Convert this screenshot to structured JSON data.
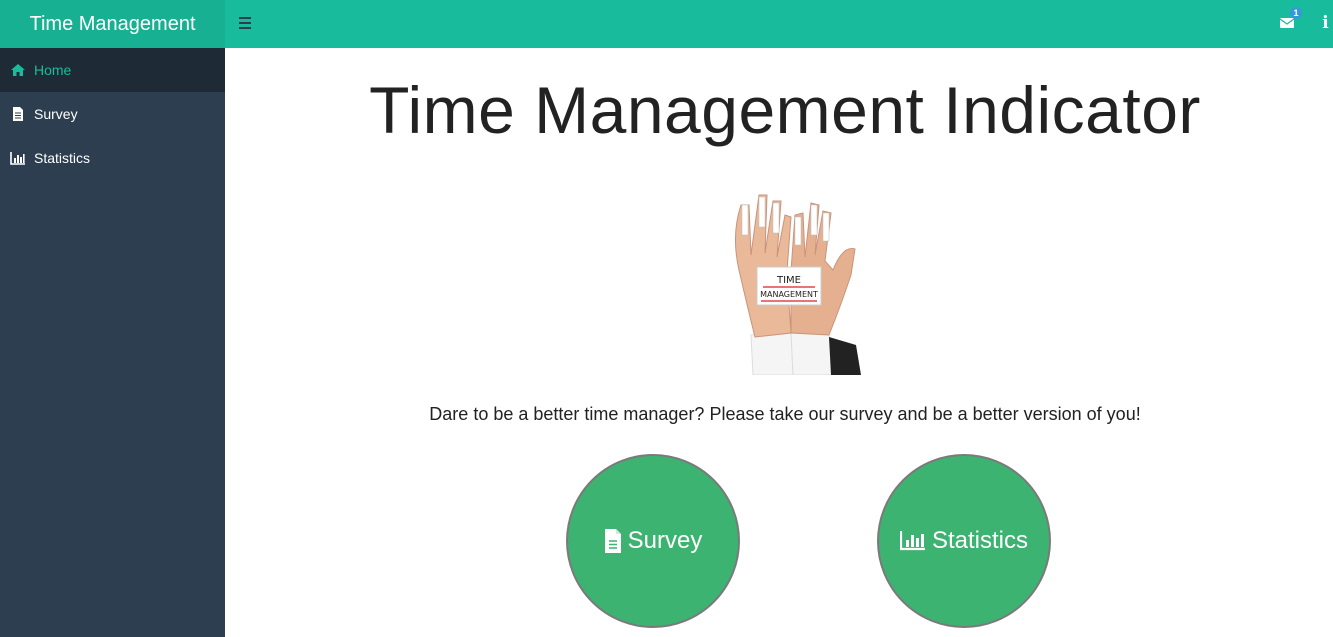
{
  "app": {
    "brand": "Time Management"
  },
  "topbar": {
    "notification_count": "1"
  },
  "sidebar": {
    "items": [
      {
        "label": "Home",
        "icon": "home-icon",
        "active": true
      },
      {
        "label": "Survey",
        "icon": "file-icon",
        "active": false
      },
      {
        "label": "Statistics",
        "icon": "bar-chart-icon",
        "active": false
      }
    ]
  },
  "main": {
    "title": "Time Management Indicator",
    "tagline": "Dare to be a better time manager? Please take our survey and be a better version of you!",
    "hero_card_text": "TIME MANAGEMENT",
    "buttons": {
      "survey": "Survey",
      "statistics": "Statistics"
    }
  },
  "colors": {
    "accent": "#18bc9c",
    "sidebar_bg": "#2c3e50",
    "sidebar_active_bg": "#1e2b37",
    "circle_button": "#3cb371",
    "badge": "#3498db"
  }
}
